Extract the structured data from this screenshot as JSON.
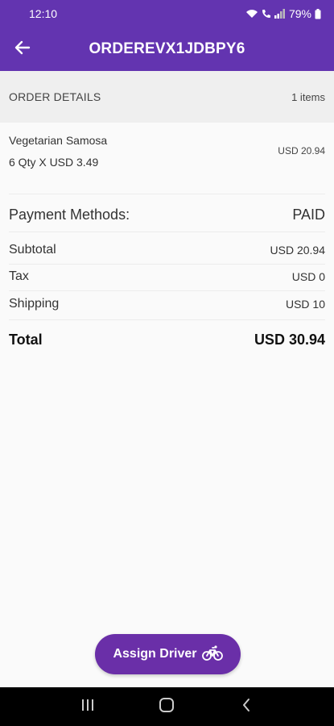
{
  "status_bar": {
    "time": "12:10",
    "battery": "79%"
  },
  "app_bar": {
    "title": "ORDEREVX1JDBPY6",
    "back_icon": "arrow-left-icon"
  },
  "order_details": {
    "title": "ORDER DETAILS",
    "item_count": "1 items",
    "items": [
      {
        "name": "Vegetarian Samosa",
        "qty_line": "6 Qty X USD 3.49",
        "price": "USD 20.94"
      }
    ]
  },
  "payment": {
    "label": "Payment Methods:",
    "status": "PAID"
  },
  "summary": {
    "subtotal_label": "Subtotal",
    "subtotal_value": "USD 20.94",
    "tax_label": "Tax",
    "tax_value": "USD 0",
    "shipping_label": "Shipping",
    "shipping_value": "USD 10",
    "total_label": "Total",
    "total_value": "USD 30.94"
  },
  "actions": {
    "assign_driver_label": "Assign Driver",
    "assign_driver_icon": "bicycle-icon"
  },
  "nav_bar": {
    "recents_icon": "recents-icon",
    "home_icon": "home-icon",
    "back_icon": "back-chevron-icon"
  },
  "colors": {
    "primary": "#6334b0",
    "button": "#6a2fa8",
    "header_bg": "#efefef",
    "background": "#fafafa"
  }
}
